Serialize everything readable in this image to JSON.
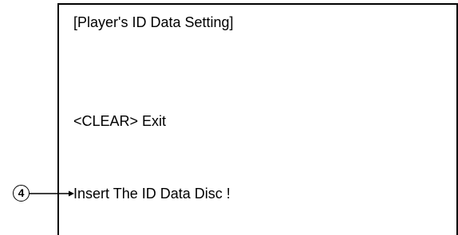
{
  "screen": {
    "title": "[Player's ID Data Setting]",
    "clear_instruction": "<CLEAR>  Exit",
    "insert_message": "Insert The ID Data Disc !"
  },
  "callout": {
    "number": "4",
    "glyph": "④"
  }
}
